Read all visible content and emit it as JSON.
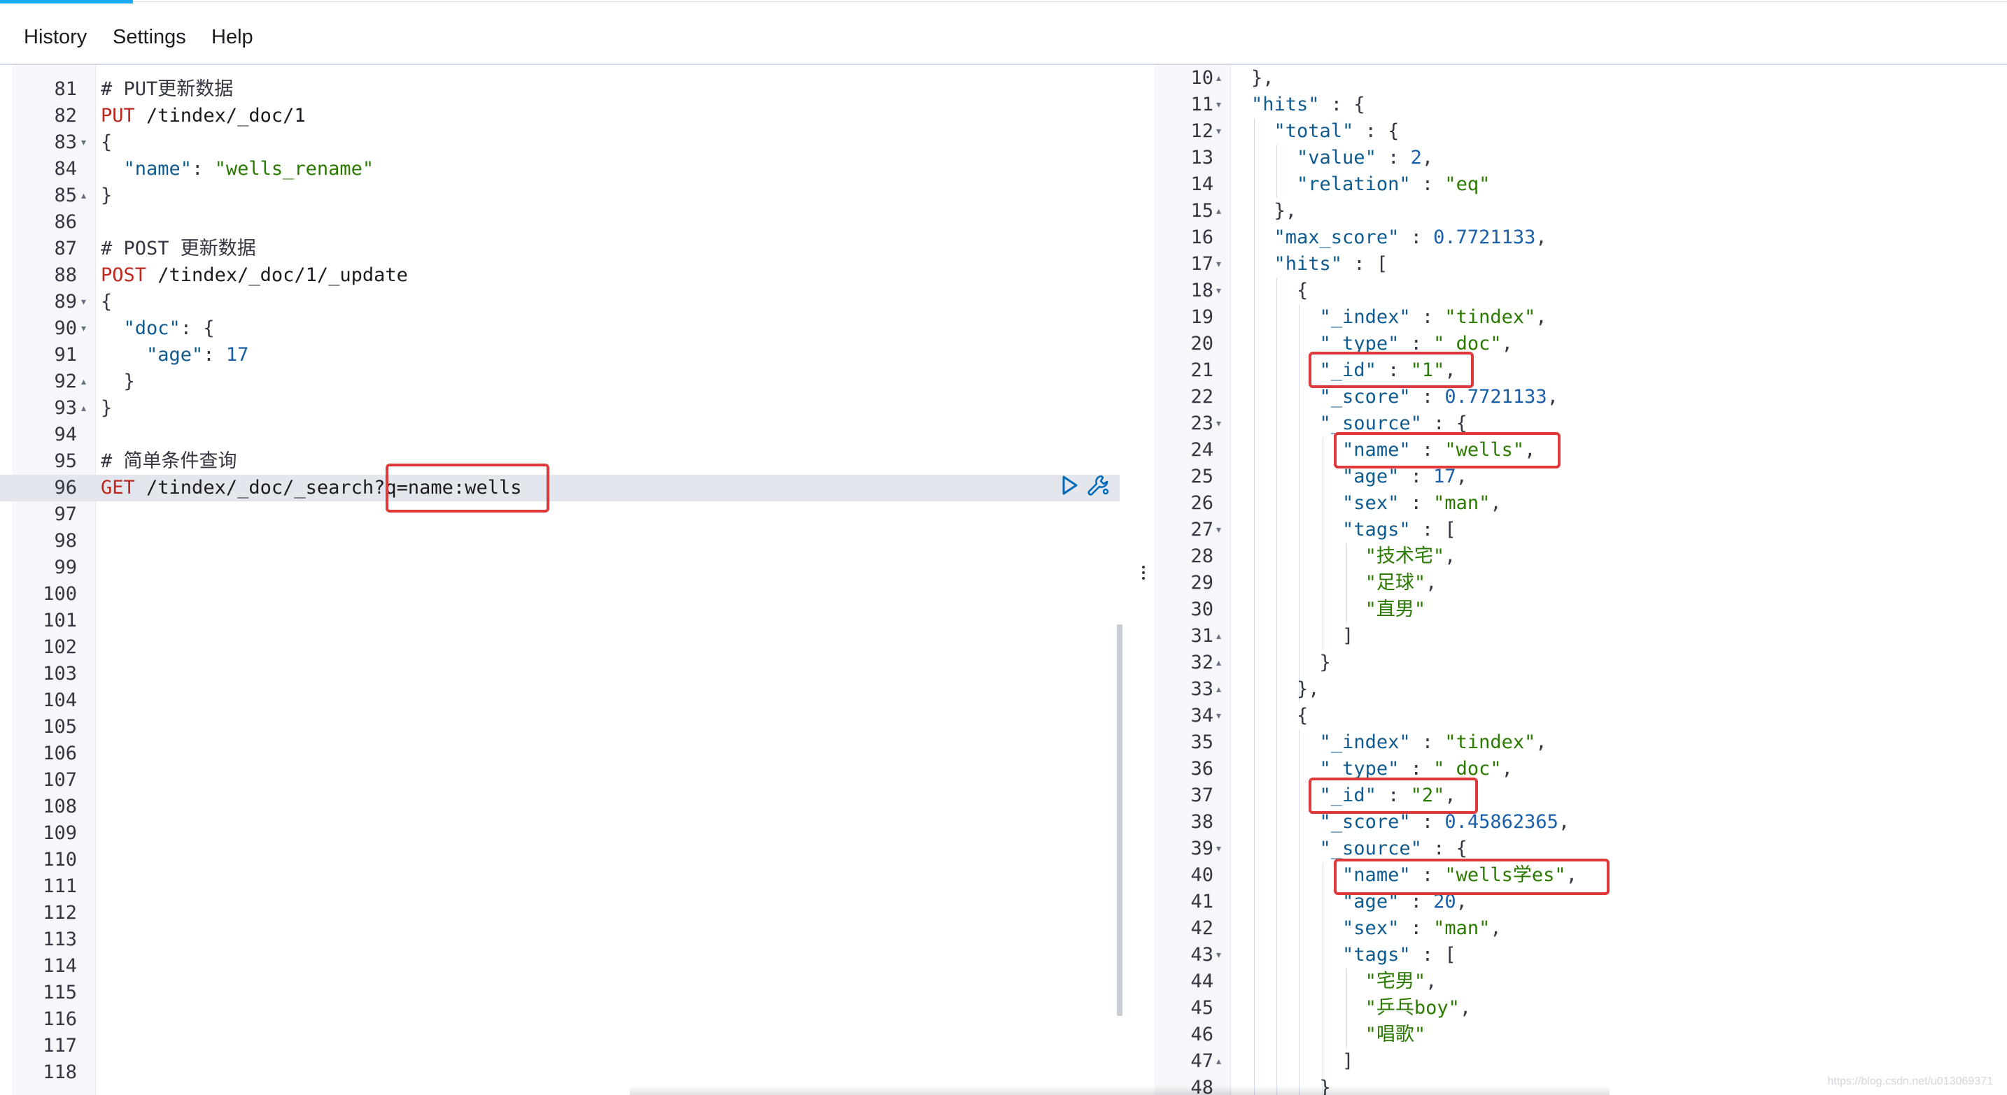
{
  "menu": {
    "items": [
      "History",
      "Settings",
      "Help"
    ]
  },
  "request_editor": {
    "top_partial_line": "80",
    "lines": [
      {
        "n": "81",
        "fold": "",
        "parts": [
          [
            "c-comment",
            "# PUT更新数据"
          ]
        ]
      },
      {
        "n": "82",
        "fold": "",
        "parts": [
          [
            "c-method",
            "PUT"
          ],
          [
            "c-url",
            " /tindex/_doc/1"
          ]
        ]
      },
      {
        "n": "83",
        "fold": "▾",
        "parts": [
          [
            "c-punc",
            "{"
          ]
        ]
      },
      {
        "n": "84",
        "fold": "",
        "parts": [
          [
            "c-punc",
            "  "
          ],
          [
            "c-key",
            "\"name\""
          ],
          [
            "c-punc",
            ": "
          ],
          [
            "c-str",
            "\"wells_rename\""
          ]
        ]
      },
      {
        "n": "85",
        "fold": "▴",
        "parts": [
          [
            "c-punc",
            "}"
          ]
        ]
      },
      {
        "n": "86",
        "fold": "",
        "parts": []
      },
      {
        "n": "87",
        "fold": "",
        "parts": [
          [
            "c-comment",
            "# POST 更新数据"
          ]
        ]
      },
      {
        "n": "88",
        "fold": "",
        "parts": [
          [
            "c-method",
            "POST"
          ],
          [
            "c-url",
            " /tindex/_doc/1/_update"
          ]
        ]
      },
      {
        "n": "89",
        "fold": "▾",
        "parts": [
          [
            "c-punc",
            "{"
          ]
        ]
      },
      {
        "n": "90",
        "fold": "▾",
        "parts": [
          [
            "c-punc",
            "  "
          ],
          [
            "c-key",
            "\"doc\""
          ],
          [
            "c-punc",
            ": {"
          ]
        ]
      },
      {
        "n": "91",
        "fold": "",
        "parts": [
          [
            "c-punc",
            "    "
          ],
          [
            "c-key",
            "\"age\""
          ],
          [
            "c-punc",
            ": "
          ],
          [
            "c-num",
            "17"
          ]
        ]
      },
      {
        "n": "92",
        "fold": "▴",
        "parts": [
          [
            "c-punc",
            "  }"
          ]
        ]
      },
      {
        "n": "93",
        "fold": "▴",
        "parts": [
          [
            "c-punc",
            "}"
          ]
        ]
      },
      {
        "n": "94",
        "fold": "",
        "parts": []
      },
      {
        "n": "95",
        "fold": "",
        "parts": [
          [
            "c-comment",
            "# 简单条件查询"
          ]
        ]
      },
      {
        "n": "96",
        "fold": "",
        "active": true,
        "parts": [
          [
            "c-method",
            "GET"
          ],
          [
            "c-url",
            " /tindex/_doc/_search?q=name:wells"
          ]
        ]
      },
      {
        "n": "97",
        "fold": "",
        "parts": []
      },
      {
        "n": "98",
        "fold": "",
        "parts": []
      },
      {
        "n": "99",
        "fold": "",
        "parts": []
      },
      {
        "n": "100",
        "fold": "",
        "parts": []
      },
      {
        "n": "101",
        "fold": "",
        "parts": []
      },
      {
        "n": "102",
        "fold": "",
        "parts": []
      },
      {
        "n": "103",
        "fold": "",
        "parts": []
      },
      {
        "n": "104",
        "fold": "",
        "parts": []
      },
      {
        "n": "105",
        "fold": "",
        "parts": []
      },
      {
        "n": "106",
        "fold": "",
        "parts": []
      },
      {
        "n": "107",
        "fold": "",
        "parts": []
      },
      {
        "n": "108",
        "fold": "",
        "parts": []
      },
      {
        "n": "109",
        "fold": "",
        "parts": []
      },
      {
        "n": "110",
        "fold": "",
        "parts": []
      },
      {
        "n": "111",
        "fold": "",
        "parts": []
      },
      {
        "n": "112",
        "fold": "",
        "parts": []
      },
      {
        "n": "113",
        "fold": "",
        "parts": []
      },
      {
        "n": "114",
        "fold": "",
        "parts": []
      },
      {
        "n": "115",
        "fold": "",
        "parts": []
      },
      {
        "n": "116",
        "fold": "",
        "parts": []
      },
      {
        "n": "117",
        "fold": "",
        "parts": []
      },
      {
        "n": "118",
        "fold": "",
        "parts": []
      }
    ]
  },
  "response_viewer": {
    "lines": [
      {
        "n": "10",
        "fold": "▴",
        "parts": [
          [
            "c-punc",
            "},"
          ]
        ]
      },
      {
        "n": "11",
        "fold": "▾",
        "parts": [
          [
            "c-key",
            "\"hits\""
          ],
          [
            "c-punc",
            " : {"
          ]
        ]
      },
      {
        "n": "12",
        "fold": "▾",
        "parts": [
          [
            "c-punc",
            "  "
          ],
          [
            "c-key",
            "\"total\""
          ],
          [
            "c-punc",
            " : {"
          ]
        ]
      },
      {
        "n": "13",
        "fold": "",
        "parts": [
          [
            "c-punc",
            "    "
          ],
          [
            "c-key",
            "\"value\""
          ],
          [
            "c-punc",
            " : "
          ],
          [
            "c-num",
            "2"
          ],
          [
            "c-punc",
            ","
          ]
        ]
      },
      {
        "n": "14",
        "fold": "",
        "parts": [
          [
            "c-punc",
            "    "
          ],
          [
            "c-key",
            "\"relation\""
          ],
          [
            "c-punc",
            " : "
          ],
          [
            "c-str",
            "\"eq\""
          ]
        ]
      },
      {
        "n": "15",
        "fold": "▴",
        "parts": [
          [
            "c-punc",
            "  },"
          ]
        ]
      },
      {
        "n": "16",
        "fold": "",
        "parts": [
          [
            "c-punc",
            "  "
          ],
          [
            "c-key",
            "\"max_score\""
          ],
          [
            "c-punc",
            " : "
          ],
          [
            "c-num",
            "0.7721133"
          ],
          [
            "c-punc",
            ","
          ]
        ]
      },
      {
        "n": "17",
        "fold": "▾",
        "parts": [
          [
            "c-punc",
            "  "
          ],
          [
            "c-key",
            "\"hits\""
          ],
          [
            "c-punc",
            " : ["
          ]
        ]
      },
      {
        "n": "18",
        "fold": "▾",
        "parts": [
          [
            "c-punc",
            "    {"
          ]
        ]
      },
      {
        "n": "19",
        "fold": "",
        "parts": [
          [
            "c-punc",
            "      "
          ],
          [
            "c-key",
            "\"_index\""
          ],
          [
            "c-punc",
            " : "
          ],
          [
            "c-str",
            "\"tindex\""
          ],
          [
            "c-punc",
            ","
          ]
        ]
      },
      {
        "n": "20",
        "fold": "",
        "parts": [
          [
            "c-punc",
            "      "
          ],
          [
            "c-key",
            "\"_type\""
          ],
          [
            "c-punc",
            " : "
          ],
          [
            "c-str",
            "\"_doc\""
          ],
          [
            "c-punc",
            ","
          ]
        ]
      },
      {
        "n": "21",
        "fold": "",
        "parts": [
          [
            "c-punc",
            "      "
          ],
          [
            "c-key",
            "\"_id\""
          ],
          [
            "c-punc",
            " : "
          ],
          [
            "c-str",
            "\"1\""
          ],
          [
            "c-punc",
            ","
          ]
        ]
      },
      {
        "n": "22",
        "fold": "",
        "parts": [
          [
            "c-punc",
            "      "
          ],
          [
            "c-key",
            "\"_score\""
          ],
          [
            "c-punc",
            " : "
          ],
          [
            "c-num",
            "0.7721133"
          ],
          [
            "c-punc",
            ","
          ]
        ]
      },
      {
        "n": "23",
        "fold": "▾",
        "parts": [
          [
            "c-punc",
            "      "
          ],
          [
            "c-key",
            "\"_source\""
          ],
          [
            "c-punc",
            " : {"
          ]
        ]
      },
      {
        "n": "24",
        "fold": "",
        "parts": [
          [
            "c-punc",
            "        "
          ],
          [
            "c-key",
            "\"name\""
          ],
          [
            "c-punc",
            " : "
          ],
          [
            "c-str",
            "\"wells\""
          ],
          [
            "c-punc",
            ","
          ]
        ]
      },
      {
        "n": "25",
        "fold": "",
        "parts": [
          [
            "c-punc",
            "        "
          ],
          [
            "c-key",
            "\"age\""
          ],
          [
            "c-punc",
            " : "
          ],
          [
            "c-num",
            "17"
          ],
          [
            "c-punc",
            ","
          ]
        ]
      },
      {
        "n": "26",
        "fold": "",
        "parts": [
          [
            "c-punc",
            "        "
          ],
          [
            "c-key",
            "\"sex\""
          ],
          [
            "c-punc",
            " : "
          ],
          [
            "c-str",
            "\"man\""
          ],
          [
            "c-punc",
            ","
          ]
        ]
      },
      {
        "n": "27",
        "fold": "▾",
        "parts": [
          [
            "c-punc",
            "        "
          ],
          [
            "c-key",
            "\"tags\""
          ],
          [
            "c-punc",
            " : ["
          ]
        ]
      },
      {
        "n": "28",
        "fold": "",
        "parts": [
          [
            "c-punc",
            "          "
          ],
          [
            "c-str",
            "\"技术宅\""
          ],
          [
            "c-punc",
            ","
          ]
        ]
      },
      {
        "n": "29",
        "fold": "",
        "parts": [
          [
            "c-punc",
            "          "
          ],
          [
            "c-str",
            "\"足球\""
          ],
          [
            "c-punc",
            ","
          ]
        ]
      },
      {
        "n": "30",
        "fold": "",
        "parts": [
          [
            "c-punc",
            "          "
          ],
          [
            "c-str",
            "\"直男\""
          ]
        ]
      },
      {
        "n": "31",
        "fold": "▴",
        "parts": [
          [
            "c-punc",
            "        ]"
          ]
        ]
      },
      {
        "n": "32",
        "fold": "▴",
        "parts": [
          [
            "c-punc",
            "      }"
          ]
        ]
      },
      {
        "n": "33",
        "fold": "▴",
        "parts": [
          [
            "c-punc",
            "    },"
          ]
        ]
      },
      {
        "n": "34",
        "fold": "▾",
        "parts": [
          [
            "c-punc",
            "    {"
          ]
        ]
      },
      {
        "n": "35",
        "fold": "",
        "parts": [
          [
            "c-punc",
            "      "
          ],
          [
            "c-key",
            "\"_index\""
          ],
          [
            "c-punc",
            " : "
          ],
          [
            "c-str",
            "\"tindex\""
          ],
          [
            "c-punc",
            ","
          ]
        ]
      },
      {
        "n": "36",
        "fold": "",
        "parts": [
          [
            "c-punc",
            "      "
          ],
          [
            "c-key",
            "\"_type\""
          ],
          [
            "c-punc",
            " : "
          ],
          [
            "c-str",
            "\"_doc\""
          ],
          [
            "c-punc",
            ","
          ]
        ]
      },
      {
        "n": "37",
        "fold": "",
        "parts": [
          [
            "c-punc",
            "      "
          ],
          [
            "c-key",
            "\"_id\""
          ],
          [
            "c-punc",
            " : "
          ],
          [
            "c-str",
            "\"2\""
          ],
          [
            "c-punc",
            ","
          ]
        ]
      },
      {
        "n": "38",
        "fold": "",
        "parts": [
          [
            "c-punc",
            "      "
          ],
          [
            "c-key",
            "\"_score\""
          ],
          [
            "c-punc",
            " : "
          ],
          [
            "c-num",
            "0.45862365"
          ],
          [
            "c-punc",
            ","
          ]
        ]
      },
      {
        "n": "39",
        "fold": "▾",
        "parts": [
          [
            "c-punc",
            "      "
          ],
          [
            "c-key",
            "\"_source\""
          ],
          [
            "c-punc",
            " : {"
          ]
        ]
      },
      {
        "n": "40",
        "fold": "",
        "parts": [
          [
            "c-punc",
            "        "
          ],
          [
            "c-key",
            "\"name\""
          ],
          [
            "c-punc",
            " : "
          ],
          [
            "c-str",
            "\"wells学es\""
          ],
          [
            "c-punc",
            ","
          ]
        ]
      },
      {
        "n": "41",
        "fold": "",
        "parts": [
          [
            "c-punc",
            "        "
          ],
          [
            "c-key",
            "\"age\""
          ],
          [
            "c-punc",
            " : "
          ],
          [
            "c-num",
            "20"
          ],
          [
            "c-punc",
            ","
          ]
        ]
      },
      {
        "n": "42",
        "fold": "",
        "parts": [
          [
            "c-punc",
            "        "
          ],
          [
            "c-key",
            "\"sex\""
          ],
          [
            "c-punc",
            " : "
          ],
          [
            "c-str",
            "\"man\""
          ],
          [
            "c-punc",
            ","
          ]
        ]
      },
      {
        "n": "43",
        "fold": "▾",
        "parts": [
          [
            "c-punc",
            "        "
          ],
          [
            "c-key",
            "\"tags\""
          ],
          [
            "c-punc",
            " : ["
          ]
        ]
      },
      {
        "n": "44",
        "fold": "",
        "parts": [
          [
            "c-punc",
            "          "
          ],
          [
            "c-str",
            "\"宅男\""
          ],
          [
            "c-punc",
            ","
          ]
        ]
      },
      {
        "n": "45",
        "fold": "",
        "parts": [
          [
            "c-punc",
            "          "
          ],
          [
            "c-str",
            "\"乒乓boy\""
          ],
          [
            "c-punc",
            ","
          ]
        ]
      },
      {
        "n": "46",
        "fold": "",
        "parts": [
          [
            "c-punc",
            "          "
          ],
          [
            "c-str",
            "\"唱歌\""
          ]
        ]
      },
      {
        "n": "47",
        "fold": "▴",
        "parts": [
          [
            "c-punc",
            "        ]"
          ]
        ]
      },
      {
        "n": "48",
        "fold": "",
        "parts": [
          [
            "c-punc",
            "      }"
          ]
        ]
      }
    ]
  },
  "highlights": {
    "color": "#e0393b",
    "query_param": "q=name:wells"
  },
  "watermark": "https://blog.csdn.net/u013069371"
}
